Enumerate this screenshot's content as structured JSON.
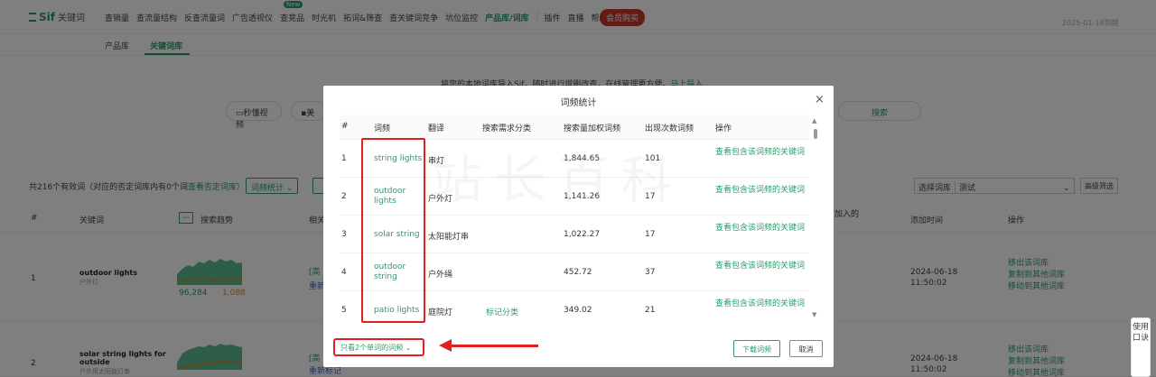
{
  "topnav": {
    "logo_text": "Sif",
    "logo_sub": "关键词",
    "items": [
      "查销量",
      "查流量结构",
      "反查流量词",
      "广告透视仪",
      "查竞品",
      "时光机",
      "拓词&筛查",
      "查关键词竞争",
      "坑位监控",
      "产品库/词库",
      "插件",
      "直播",
      "帮助"
    ],
    "new_badge": "New",
    "vip": "会员购买",
    "date": "2025-01-18到期"
  },
  "subnav": {
    "product_lib": "产品库",
    "keyword_lib": "关键词库"
  },
  "import_tip": {
    "text": "将您的本地词库导入Sif，随时进行增删改查，在线管理更方便。",
    "link": "马上导入"
  },
  "search": {
    "video": "秒懂视频",
    "market": "美",
    "button": "搜索"
  },
  "toolbar": {
    "count_text": "共216个有效词（对应的否定词库内有0个词",
    "negative_link": "查看否定词库）",
    "freq_btn": "词频统计 ⌄",
    "select_lib": "选择词库",
    "select_val": "测试",
    "advanced": "高级筛选"
  },
  "table": {
    "headers": {
      "num": "#",
      "keyword": "关键词",
      "trend": "搜索趋势",
      "related": "相关",
      "joined": "加入的",
      "added": "添加时间",
      "ops": "操作"
    },
    "trend_toggle": "〰",
    "rows": [
      {
        "num": "1",
        "keyword": "outdoor lights",
        "keyword_cn": "户外灯",
        "v1": "96,284",
        "v2": "1,088",
        "rel1": "[高",
        "rel2": "重新",
        "date": "2024-06-18",
        "time": "11:50:02",
        "op1": "移出该词库",
        "op2": "复制到其他词库",
        "op3": "移动到其他词库"
      },
      {
        "num": "2",
        "keyword": "solar string lights for outside",
        "keyword_cn": "户外用太阳能灯串",
        "rel1": "[高",
        "rel2": "重新标记",
        "date": "2024-06-18",
        "time": "11:50:02",
        "op1": "移出该词库",
        "op2": "复制到其他词库",
        "op3": "移动到其他词库"
      }
    ]
  },
  "side_button": "使用口诀",
  "modal": {
    "title": "词频统计",
    "close": "×",
    "headers": {
      "num": "#",
      "word": "词频",
      "trans": "翻译",
      "category": "搜索需求分类",
      "weighted": "搜索量加权词频",
      "occur": "出现次数词频",
      "op": "操作"
    },
    "rows": [
      {
        "num": "1",
        "word": "string lights",
        "trans": "串灯",
        "category": "",
        "weighted": "1,844.65",
        "occur": "101",
        "op": "查看包含该词频的关键词"
      },
      {
        "num": "2",
        "word": "outdoor lights",
        "trans": "户外灯",
        "category": "",
        "weighted": "1,141.26",
        "occur": "17",
        "op": "查看包含该词频的关键词"
      },
      {
        "num": "3",
        "word": "solar string",
        "trans": "太阳能灯串",
        "category": "",
        "weighted": "1,022.27",
        "occur": "17",
        "op": "查看包含该词频的关键词"
      },
      {
        "num": "4",
        "word": "outdoor string",
        "trans": "户外绳",
        "category": "",
        "weighted": "452.72",
        "occur": "37",
        "op": "查看包含该词频的关键词"
      },
      {
        "num": "5",
        "word": "patio lights",
        "trans": "庭院灯",
        "category": "标记分类",
        "weighted": "349.02",
        "occur": "21",
        "op": "查看包含该词频的关键词"
      }
    ],
    "filter": "只看2个单词的词频 ⌄",
    "download": "下载词频",
    "cancel": "取消"
  },
  "watermark": "站长百科",
  "colors": {
    "accent": "#2a9d6a",
    "highlight": "#e02020",
    "vip": "#c0392b"
  }
}
